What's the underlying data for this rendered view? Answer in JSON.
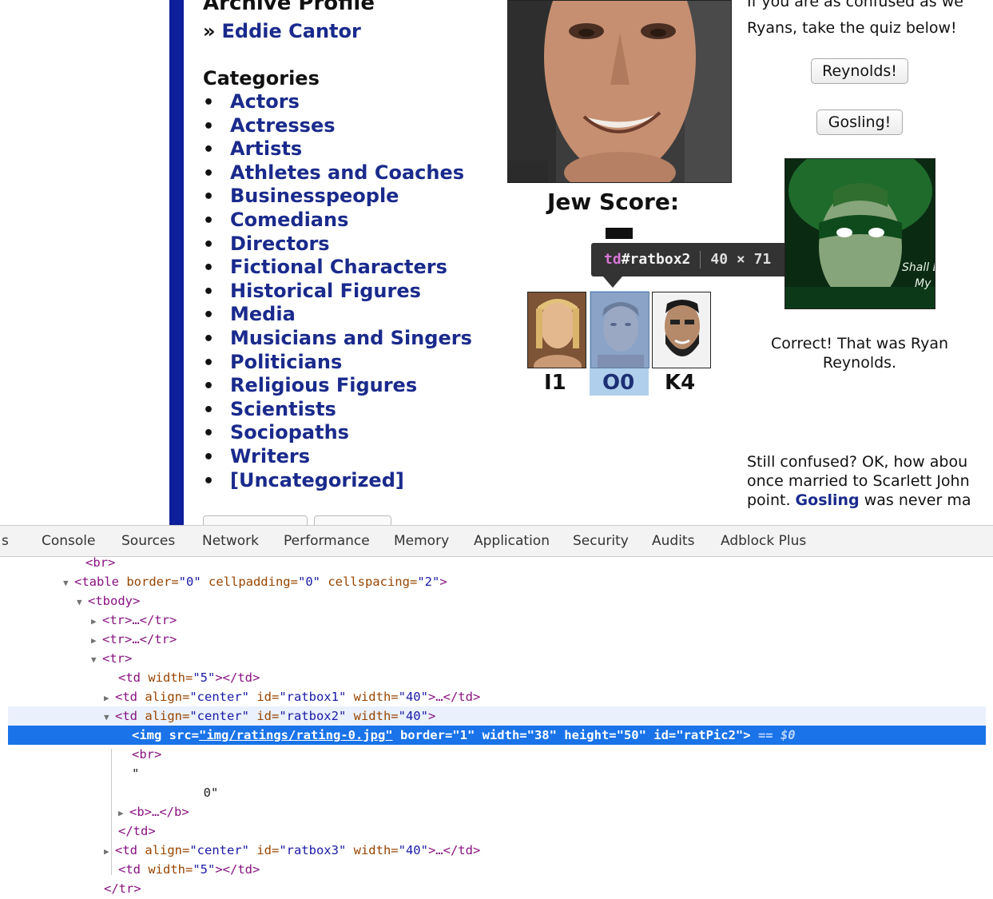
{
  "page": {
    "archive_cut": "Archive Profile",
    "eddie_raquo": "»",
    "eddie_link": "Eddie Cantor",
    "categories_heading": "Categories",
    "bullet": "•",
    "categories": [
      "Actors",
      "Actresses",
      "Artists",
      "Athletes and Coaches",
      "Businesspeople",
      "Comedians",
      "Directors",
      "Fictional Characters",
      "Historical Figures",
      "Media",
      "Musicians and Singers",
      "Politicians",
      "Religious Figures",
      "Scientists",
      "Sociopaths",
      "Writers",
      "[Uncategorized]"
    ],
    "jew_score_label": "Jew Score:",
    "ratings": [
      {
        "label": "I1"
      },
      {
        "label": "O0"
      },
      {
        "label": "K4"
      }
    ],
    "tooltip": {
      "tag": "td",
      "id": "#ratbox2",
      "dims": "40 × 71"
    },
    "right": {
      "confused_top": "If you are as confused as we",
      "ryans_text": "Ryans, take the quiz below!",
      "btn_reynolds": "Reynolds!",
      "btn_gosling": "Gosling!",
      "correct_text": "Correct! That was Ryan Reynolds.",
      "gl_caption": "Shall E My",
      "still_line1": "Still confused? OK, how abou",
      "still_line2": "once married to Scarlett John",
      "still_line3_pre": "point. ",
      "still_line3_link": "Gosling",
      "still_line3_post": " was never ma"
    }
  },
  "devtools": {
    "tabs": [
      "s",
      "Console",
      "Sources",
      "Network",
      "Performance",
      "Memory",
      "Application",
      "Security",
      "Audits",
      "Adblock Plus"
    ],
    "dom_lines": {
      "l0": "<br>",
      "l1_tag": "<table",
      "l1_a1": " border=",
      "l1_v1": "\"0\"",
      "l1_a2": " cellpadding=",
      "l1_v2": "\"0\"",
      "l1_a3": " cellspacing=",
      "l1_v3": "\"2\"",
      "l1_end": ">",
      "l2": "<tbody>",
      "l3": "<tr>…</tr>",
      "l4": "<tr>…</tr>",
      "l5": "<tr>",
      "l6_tag": "<td",
      "l6_a": " width=",
      "l6_v": "\"5\"",
      "l6_end": "></td>",
      "l7_tag": "<td",
      "l7_a1": " align=",
      "l7_v1": "\"center\"",
      "l7_a2": " id=",
      "l7_v2": "\"ratbox1\"",
      "l7_a3": " width=",
      "l7_v3": "\"40\"",
      "l7_end": ">…</td>",
      "l8_tag": "<td",
      "l8_a1": " align=",
      "l8_v1": "\"center\"",
      "l8_a2": " id=",
      "l8_v2": "\"ratbox2\"",
      "l8_a3": " width=",
      "l8_v3": "\"40\"",
      "l8_end": ">",
      "l9_tag": "<img",
      "l9_a1": " src=",
      "l9_v1": "\"img/ratings/rating-0.jpg\"",
      "l9_a2": " border=",
      "l9_v2": "\"1\"",
      "l9_a3": " width=",
      "l9_v3": "\"38\"",
      "l9_a4": " height=",
      "l9_v4": "\"50\"",
      "l9_a5": " id=",
      "l9_v5": "\"ratPic2\"",
      "l9_end": ">",
      "l9_eq": " == ",
      "l9_s0": "$0",
      "l10": "<br>",
      "l11": "\"",
      "l12": "        0\"",
      "l13": "<b>…</b>",
      "l14": "</td>",
      "l15_tag": "<td",
      "l15_a1": " align=",
      "l15_v1": "\"center\"",
      "l15_a2": " id=",
      "l15_v2": "\"ratbox3\"",
      "l15_a3": " width=",
      "l15_v3": "\"40\"",
      "l15_end": ">…</td>",
      "l16_tag": "<td",
      "l16_a": " width=",
      "l16_v": "\"5\"",
      "l16_end": "></td>",
      "l17": "</tr>"
    }
  }
}
